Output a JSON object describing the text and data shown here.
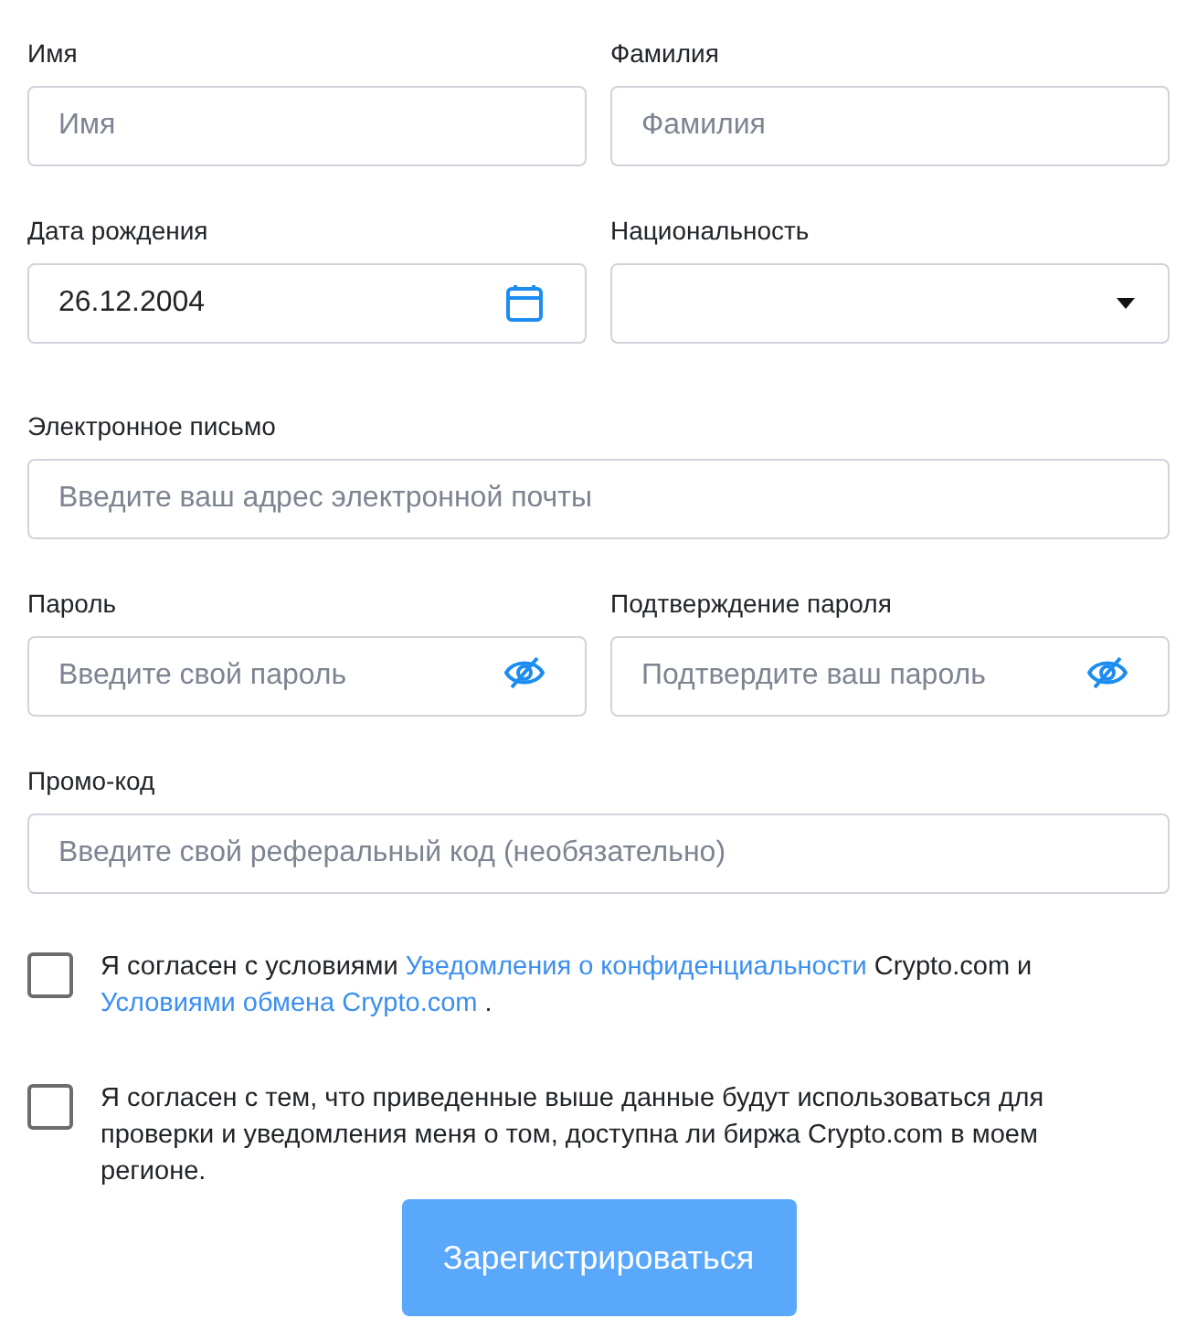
{
  "rows": [
    [
      {
        "label": "Имя",
        "kind": "text",
        "placeholder": "Имя"
      },
      {
        "label": "Фамилия",
        "kind": "text",
        "placeholder": "Фамилия"
      }
    ],
    [
      {
        "label": "Дата рождения",
        "kind": "date",
        "value": "26.12.2004"
      },
      {
        "label": "Национальность",
        "kind": "select"
      }
    ],
    [
      {
        "label": "Электронное письмо",
        "kind": "text",
        "placeholder": "Введите ваш адрес электронной почты"
      }
    ],
    [
      {
        "label": "Пароль",
        "kind": "password",
        "placeholder": "Введите свой пароль"
      },
      {
        "label": "Подтверждение пароля",
        "kind": "password",
        "placeholder": "Подтвердите ваш пароль"
      }
    ],
    [
      {
        "label": "Промо-код",
        "kind": "text",
        "placeholder": "Введите свой реферальный код (необязательно)"
      }
    ]
  ],
  "consents": [
    {
      "checked": false,
      "segments": [
        {
          "kind": "text",
          "text": "Я согласен с условиями "
        },
        {
          "kind": "link",
          "text": "Уведомления о конфиденциальности"
        },
        {
          "kind": "text",
          "text": " Crypto.com и "
        },
        {
          "kind": "link",
          "text": "Условиями обмена Crypto.com"
        },
        {
          "kind": "text",
          "text": " ."
        }
      ]
    },
    {
      "checked": false,
      "segments": [
        {
          "kind": "text",
          "text": "Я согласен с тем, что приведенные выше данные будут использоваться для проверки и уведомления меня о том, доступна ли биржа Crypto.com в моем регионе."
        }
      ]
    }
  ],
  "submit": {
    "label": "Зарегистрироваться",
    "disabled": true
  }
}
